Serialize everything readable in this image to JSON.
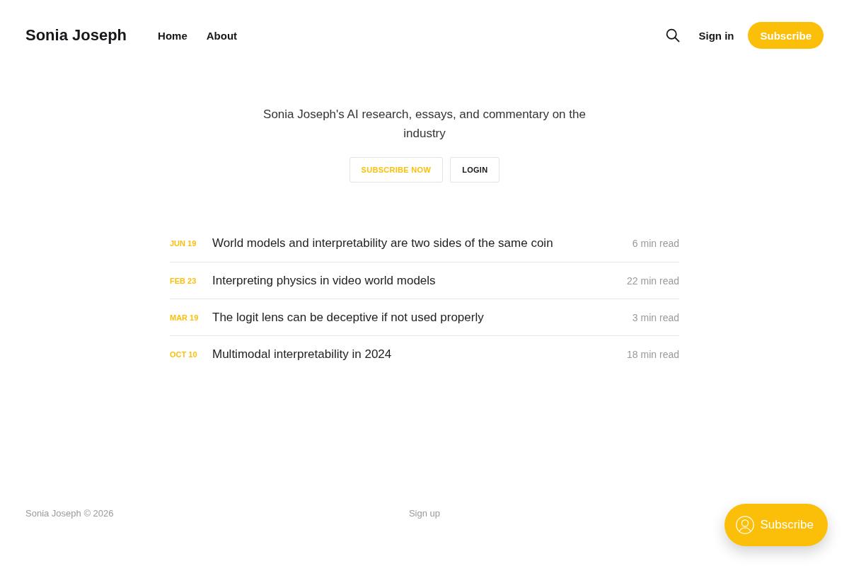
{
  "header": {
    "site_title": "Sonia Joseph",
    "nav": [
      {
        "label": "Home"
      },
      {
        "label": "About"
      }
    ],
    "sign_in": "Sign in",
    "subscribe": "Subscribe"
  },
  "hero": {
    "description": "Sonia Joseph's AI research, essays, and commentary on the industry",
    "buttons": [
      {
        "label": "SUBSCRIBE NOW",
        "kind": "primary"
      },
      {
        "label": "LOGIN",
        "kind": "secondary"
      }
    ]
  },
  "posts": [
    {
      "date": "JUN 19",
      "title": "World models and interpretability are two sides of the same coin",
      "read_time": "6 min read"
    },
    {
      "date": "FEB 23",
      "title": "Interpreting physics in video world models",
      "read_time": "22 min read"
    },
    {
      "date": "MAR 19",
      "title": "The logit lens can be deceptive if not used properly",
      "read_time": "3 min read"
    },
    {
      "date": "OCT 10",
      "title": "Multimodal interpretability in 2024",
      "read_time": "18 min read"
    }
  ],
  "footer": {
    "copyright": "Sonia Joseph © 2026",
    "links": [
      "Sign up"
    ]
  },
  "portal_button": {
    "label": "Subscribe"
  }
}
